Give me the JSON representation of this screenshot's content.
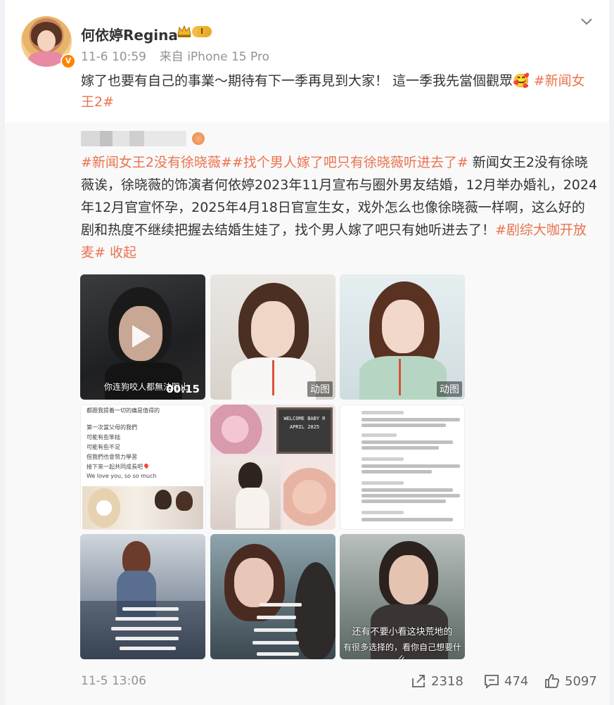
{
  "post": {
    "username": "何依婷Regina",
    "level": "I",
    "verified_badge": "V",
    "time": "11-6 10:59",
    "source": "来自 iPhone 15 Pro",
    "text_plain": "嫁了也要有自己的事業～期待有下一季再見到大家！ 這一季我先當個觀眾🥰 ",
    "text_tag": "#新闻女王2#"
  },
  "repost": {
    "tag1": "#新闻女王2没有徐晓薇#",
    "tag2": "#找个男人嫁了吧只有徐晓薇听进去了#",
    "body": " 新闻女王2没有徐晓薇诶，徐晓薇的饰演者何依婷2023年11月宣布与圈外男友结婚，12月举办婚礼，2024年12月官宣怀孕，2025年4月18日官宣生女，戏外怎么也像徐晓薇一样啊，这么好的剧和热度不继续把握去结婚生娃了，找个男人嫁了吧只有她听进去了！",
    "tag3": "#剧综大咖开放麦#",
    "collapse": " 收起",
    "media": {
      "video_duration": "00:15",
      "video_subtitle": "你连狗咬人都無法阻止",
      "gif_label": "动图",
      "img4_lines": [
        "都跟我提着一切的痛是值得的",
        "第一次當父母的我們",
        "可能有些笨拙",
        "可能有些不足",
        "但我們也會努力學習",
        "接下來一起共同成長吧🎈",
        "We love you, so so much"
      ],
      "img5_letter": "WELCOME BABY R APRIL 2025",
      "img9_sub1": "还有不要小看这块荒地的",
      "img9_sub2": "有很多选择的，看你自己想要什么"
    },
    "time": "11-5 13:06",
    "share_count": "2318",
    "comment_count": "474",
    "like_count": "5097"
  },
  "icons": [
    "chevron-down-icon",
    "crown-icon",
    "share-icon",
    "comment-icon",
    "like-icon",
    "play-icon"
  ]
}
